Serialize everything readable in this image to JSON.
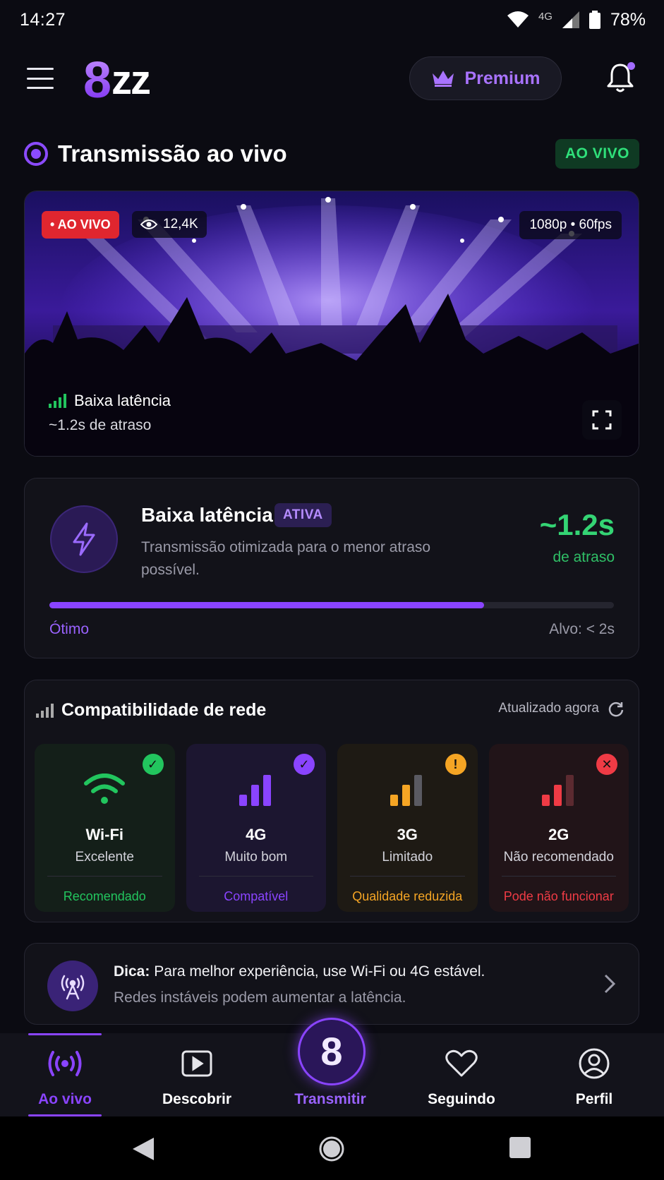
{
  "status_bar": {
    "time": "14:27",
    "network": "4G",
    "battery": "78%"
  },
  "header": {
    "logo_digit": "8",
    "logo_text": "zz",
    "premium_label": "Premium",
    "accent": "#8a44ff"
  },
  "section": {
    "title": "Transmissão ao vivo",
    "live_pill": "AO VIVO"
  },
  "video": {
    "live_badge": "• AO VIVO",
    "viewers": "12,4K",
    "quality": "1080p • 60fps",
    "latency_label": "Baixa latência",
    "delay_label": "~1.2s de atraso"
  },
  "latency_card": {
    "title": "Baixa latência",
    "status_pill": "ATIVA",
    "description": "Transmissão otimizada para o menor atraso possível.",
    "value": "~1.2s",
    "unit": "de atraso",
    "progress_fraction": 0.77,
    "rating": "Ótimo",
    "target": "Alvo: < 2s"
  },
  "compatibility": {
    "title": "Compatibilidade de rede",
    "updated": "Atualizado agora",
    "networks": [
      {
        "name": "Wi-Fi",
        "quality": "Excelente",
        "status": "Recomendado",
        "color": "#22c55e",
        "bg": "#141f19",
        "check": "✓"
      },
      {
        "name": "4G",
        "quality": "Muito bom",
        "status": "Compatível",
        "color": "#8a44ff",
        "bg": "#1c1630",
        "check": "✓"
      },
      {
        "name": "3G",
        "quality": "Limitado",
        "status": "Qualidade reduzida",
        "color": "#f5a524",
        "bg": "#1e1a14",
        "check": "!"
      },
      {
        "name": "2G",
        "quality": "Não recomendado",
        "status": "Pode não funcionar",
        "color": "#ef3b45",
        "bg": "#211418",
        "check": "✕"
      }
    ]
  },
  "tip": {
    "label": "Dica:",
    "text": " Para melhor experiência, use Wi-Fi ou 4G estável.",
    "subtext": "Redes instáveis podem aumentar a latência."
  },
  "bottom_nav": {
    "items": [
      {
        "label": "Ao vivo",
        "icon": "broadcast-icon"
      },
      {
        "label": "Descobrir",
        "icon": "play-square-icon"
      },
      {
        "label": "Transmitir",
        "icon": "logo-8-icon",
        "glyph": "8"
      },
      {
        "label": "Seguindo",
        "icon": "heart-icon"
      },
      {
        "label": "Perfil",
        "icon": "user-circle-icon"
      }
    ]
  }
}
